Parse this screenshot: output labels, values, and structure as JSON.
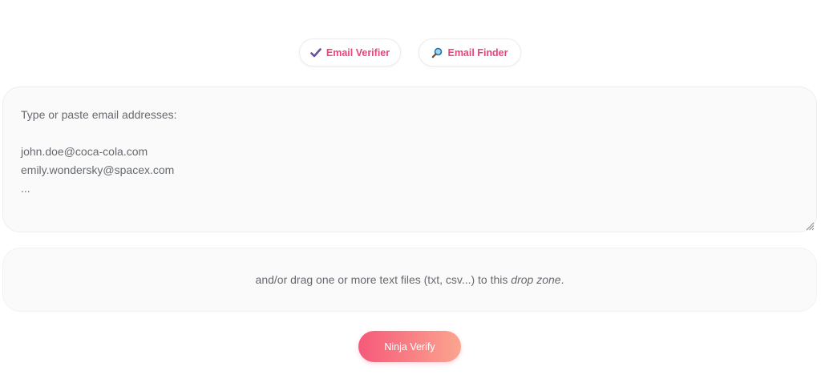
{
  "tabs": {
    "verifier": {
      "label": "Email Verifier",
      "icon": "checkmark-icon"
    },
    "finder": {
      "label": "Email Finder",
      "icon": "magnifier-icon"
    }
  },
  "input": {
    "placeholder": "Type or paste email addresses:\n\njohn.doe@coca-cola.com\nemily.wondersky@spacex.com\n..."
  },
  "dropzone": {
    "text_before": "and/or drag one or more text files (txt, csv...) to this ",
    "text_emphasis": "drop zone",
    "text_after": "."
  },
  "actions": {
    "verify_label": "Ninja Verify"
  },
  "colors": {
    "accent": "#e8457a",
    "button_gradient_start": "#f6597a",
    "button_gradient_end": "#fba58f",
    "text": "#666a70",
    "panel_bg": "#fafafa"
  }
}
